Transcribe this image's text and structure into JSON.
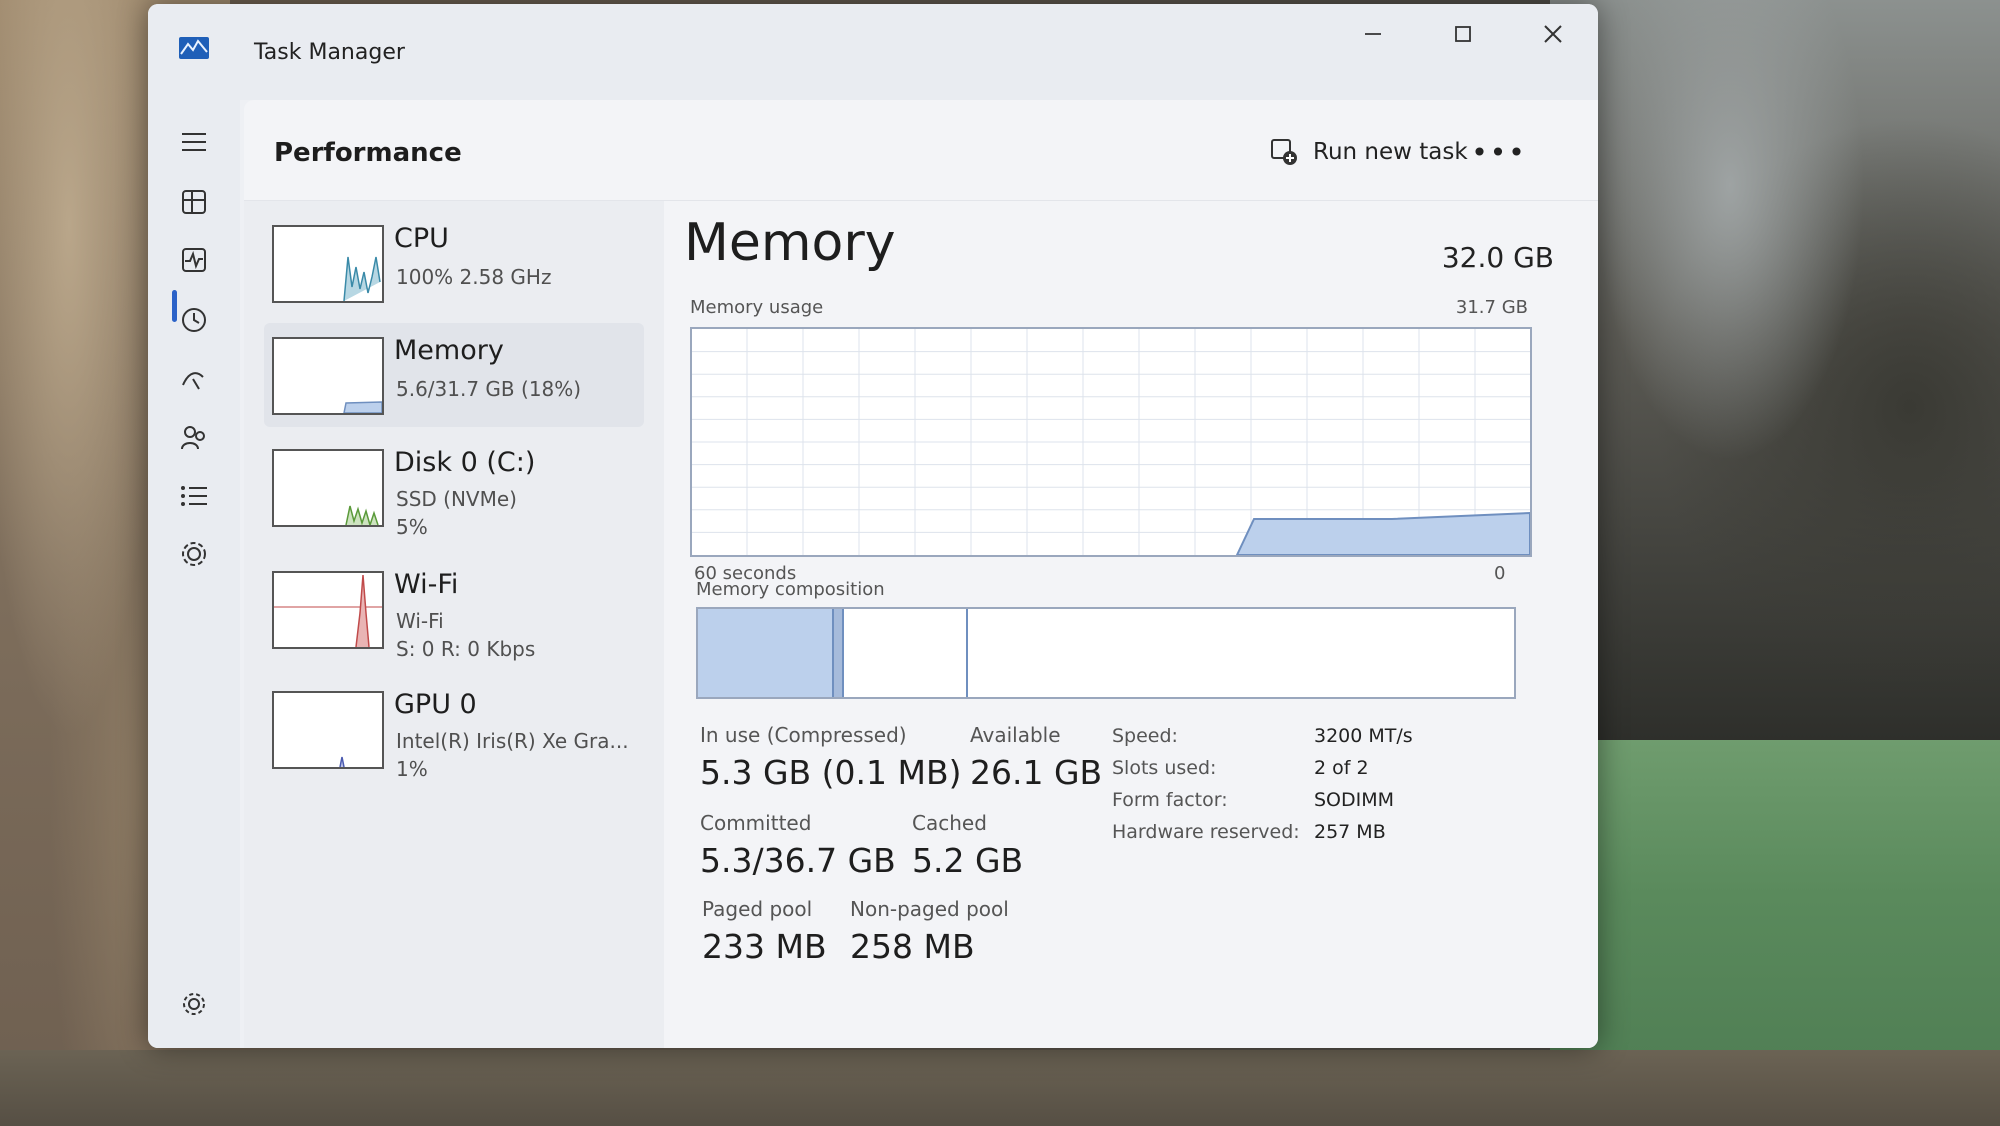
{
  "window": {
    "title": "Task Manager",
    "minimize_icon": "minimize-icon",
    "maximize_icon": "maximize-icon",
    "close_icon": "close-icon"
  },
  "nav": {
    "items": [
      "menu-icon",
      "processes-icon",
      "performance-icon",
      "app-history-icon",
      "startup-apps-icon",
      "users-icon",
      "details-icon",
      "services-icon",
      "settings-icon"
    ],
    "selected": "performance-icon"
  },
  "header": {
    "title": "Performance",
    "run_task_label": "Run new task",
    "more_label": "•••"
  },
  "devices": [
    {
      "name": "CPU",
      "line1": "100%  2.58 GHz",
      "line2": ""
    },
    {
      "name": "Memory",
      "line1": "5.6/31.7 GB (18%)",
      "line2": ""
    },
    {
      "name": "Disk 0 (C:)",
      "line1": "SSD (NVMe)",
      "line2": "5%"
    },
    {
      "name": "Wi-Fi",
      "line1": "Wi-Fi",
      "line2": "S: 0  R: 0 Kbps"
    },
    {
      "name": "GPU 0",
      "line1": "Intel(R) Iris(R) Xe Gra...",
      "line2": "1%"
    }
  ],
  "memory": {
    "title": "Memory",
    "total": "32.0 GB",
    "usage_label": "Memory usage",
    "usage_max": "31.7 GB",
    "time_left": "60 seconds",
    "time_right": "0",
    "composition_label": "Memory composition",
    "stats": {
      "in_use_label": "In use (Compressed)",
      "in_use_value": "5.3 GB (0.1 MB)",
      "available_label": "Available",
      "available_value": "26.1 GB",
      "committed_label": "Committed",
      "committed_value": "5.3/36.7 GB",
      "cached_label": "Cached",
      "cached_value": "5.2 GB",
      "paged_label": "Paged pool",
      "paged_value": "233 MB",
      "nonpaged_label": "Non-paged pool",
      "nonpaged_value": "258 MB"
    },
    "specs": {
      "speed_label": "Speed:",
      "speed_value": "3200 MT/s",
      "slots_label": "Slots used:",
      "slots_value": "2 of 2",
      "form_label": "Form factor:",
      "form_value": "SODIMM",
      "reserved_label": "Hardware reserved:",
      "reserved_value": "257 MB"
    }
  },
  "colors": {
    "accent": "#2b62c8",
    "memory_fill": "#bcd0ec",
    "memory_line": "#6f8fbf",
    "cpu_line": "#3a8aa8",
    "disk_line": "#5a9a3a",
    "wifi_line": "#c04a4a"
  }
}
